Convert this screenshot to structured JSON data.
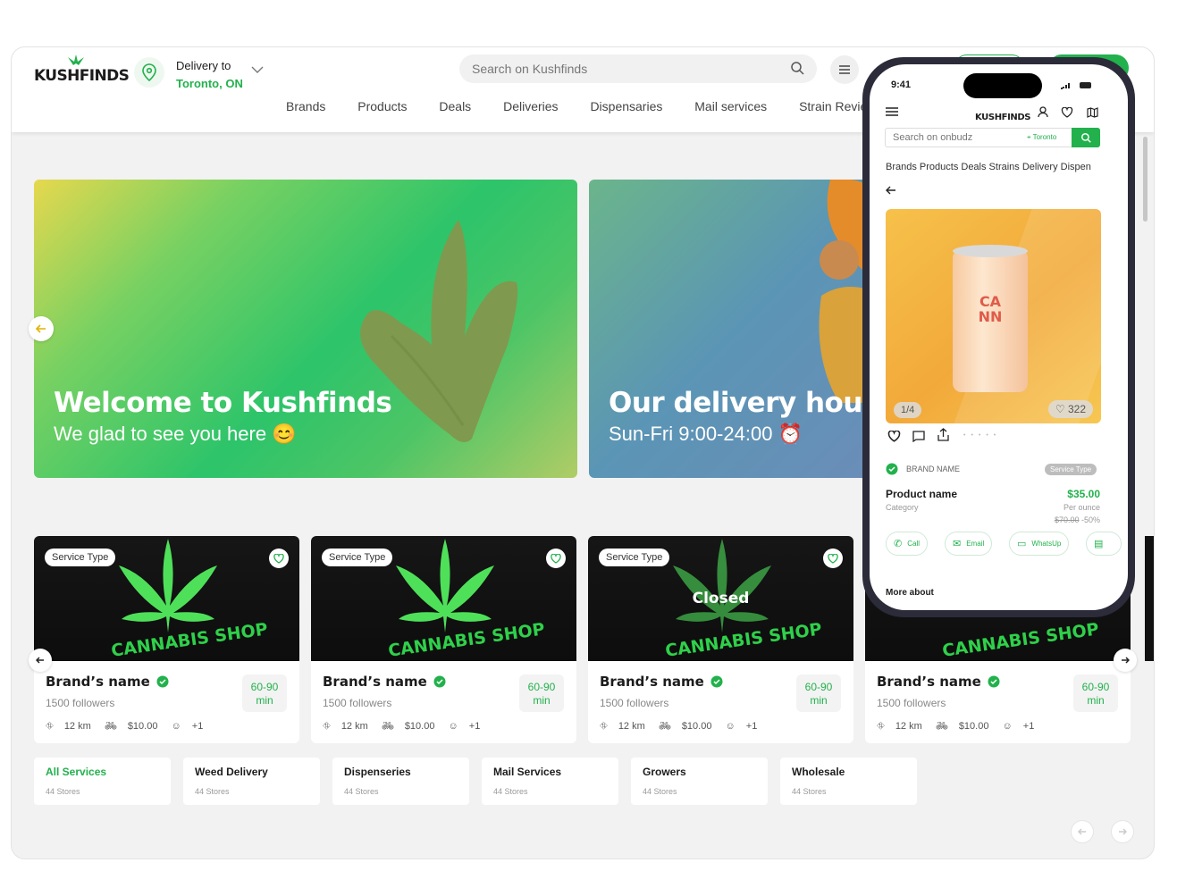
{
  "header": {
    "logo": "KUSHFINDS",
    "delivery_label": "Delivery to",
    "delivery_city": "Toronto, ON",
    "search_placeholder": "Search on Kushfinds",
    "nav": [
      "Brands",
      "Products",
      "Deals",
      "Deliveries",
      "Dispensaries",
      "Mail services",
      "Strain Revie"
    ]
  },
  "banners": [
    {
      "title": "Welcome to Kushfinds",
      "subtitle": "We glad to see you here 😊"
    },
    {
      "title": "Our delivery hours",
      "subtitle": "Sun-Fri 9:00-24:00 ⏰"
    }
  ],
  "cards": [
    {
      "service_type": "Service Type",
      "shop_text": "CANNABIS SHOP",
      "closed": "",
      "brand": "Brand’s name",
      "followers": "1500  followers",
      "time": "60-90 min",
      "distance": "12  km",
      "price": "$10.00",
      "extra": "+1"
    },
    {
      "service_type": "Service Type",
      "shop_text": "CANNABIS SHOP",
      "closed": "",
      "brand": "Brand’s name",
      "followers": "1500  followers",
      "time": "60-90 min",
      "distance": "12  km",
      "price": "$10.00",
      "extra": "+1"
    },
    {
      "service_type": "Service Type",
      "shop_text": "CANNABIS SHOP",
      "closed": "Closed",
      "brand": "Brand’s name",
      "followers": "1500  followers",
      "time": "60-90 min",
      "distance": "12  km",
      "price": "$10.00",
      "extra": "+1"
    },
    {
      "service_type": "",
      "shop_text": "CANNABIS SHOP",
      "closed": "",
      "brand": "Brand’s name",
      "followers": "1500  followers",
      "time": "60-90 min",
      "distance": "12  km",
      "price": "$10.00",
      "extra": "+1"
    }
  ],
  "categories": [
    {
      "name": "All Services",
      "count": "44  Stores",
      "active": true
    },
    {
      "name": "Weed Delivery",
      "count": "44  Stores",
      "active": false
    },
    {
      "name": "Dispenseries",
      "count": "44  Stores",
      "active": false
    },
    {
      "name": "Mail Services",
      "count": "44  Stores",
      "active": false
    },
    {
      "name": "Growers",
      "count": "44  Stores",
      "active": false
    },
    {
      "name": "Wholesale",
      "count": "44  Stores",
      "active": false
    }
  ],
  "phone": {
    "time": "9:41",
    "logo": "KUSHFINDS",
    "search_placeholder": "Search on onbudz",
    "location": "Toronto",
    "nav": "Brands  Products  Deals  Strains  Delivery  Dispen",
    "can_text": "CA\nNN",
    "image_counter": "1/4",
    "likes": "322",
    "brand_name": "BRAND NAME",
    "service_type": "Service Type",
    "product_name": "Product name",
    "category": "Category",
    "price": "$35.00",
    "unit": "Per ounce",
    "old_price": "$70.00",
    "discount": "-50%",
    "buttons": [
      "Call",
      "Email",
      "WhatsUp"
    ],
    "more_about": "More about"
  },
  "colors": {
    "accent": "#22b14c",
    "dark": "#1c1c1c"
  }
}
